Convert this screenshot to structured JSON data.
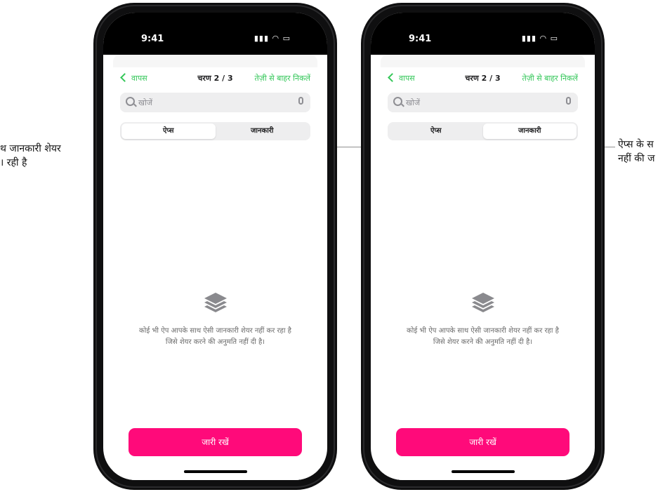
{
  "phones": [
    {
      "status": {
        "time": "9:41",
        "icons": "signal-wifi-battery"
      },
      "nav": {
        "back_label": "वापस",
        "step_label": "चरण 2 / 3",
        "exit_label": "तेज़ी से बाहर निकलें"
      },
      "search": {
        "placeholder": "खोजें"
      },
      "segments": [
        {
          "label": "ऐप्स",
          "selected": true
        },
        {
          "label": "जानकारी",
          "selected": false
        }
      ],
      "empty_state": {
        "icon": "stack-layers-icon",
        "message": "कोई भी ऐप आपके साथ ऐसी जानकारी शेयर नहीं कर रहा है जिसे शेयर करने की अनुमति नहीं दी है।"
      },
      "cta_label": "जारी रखें"
    },
    {
      "status": {
        "time": "9:41",
        "icons": "signal-wifi-battery"
      },
      "nav": {
        "back_label": "वापस",
        "step_label": "चरण 2 / 3",
        "exit_label": "तेज़ी से बाहर निकलें"
      },
      "search": {
        "placeholder": "खोजें"
      },
      "segments": [
        {
          "label": "ऐप्स",
          "selected": false
        },
        {
          "label": "जानकारी",
          "selected": true
        }
      ],
      "empty_state": {
        "icon": "stack-layers-icon",
        "message": "कोई भी ऐप आपके साथ ऐसी जानकारी शेयर नहीं कर रहा है जिसे शेयर करने की अनुमति नहीं दी है।"
      },
      "cta_label": "जारी रखें"
    }
  ],
  "callouts": {
    "left": [
      "थ जानकारी शेयर",
      "। रही है"
    ],
    "right": [
      "ऐप्स के स",
      "नहीं की ज"
    ]
  },
  "colors": {
    "accent_green": "#34c759",
    "cta_pink": "#ff0a7a"
  }
}
